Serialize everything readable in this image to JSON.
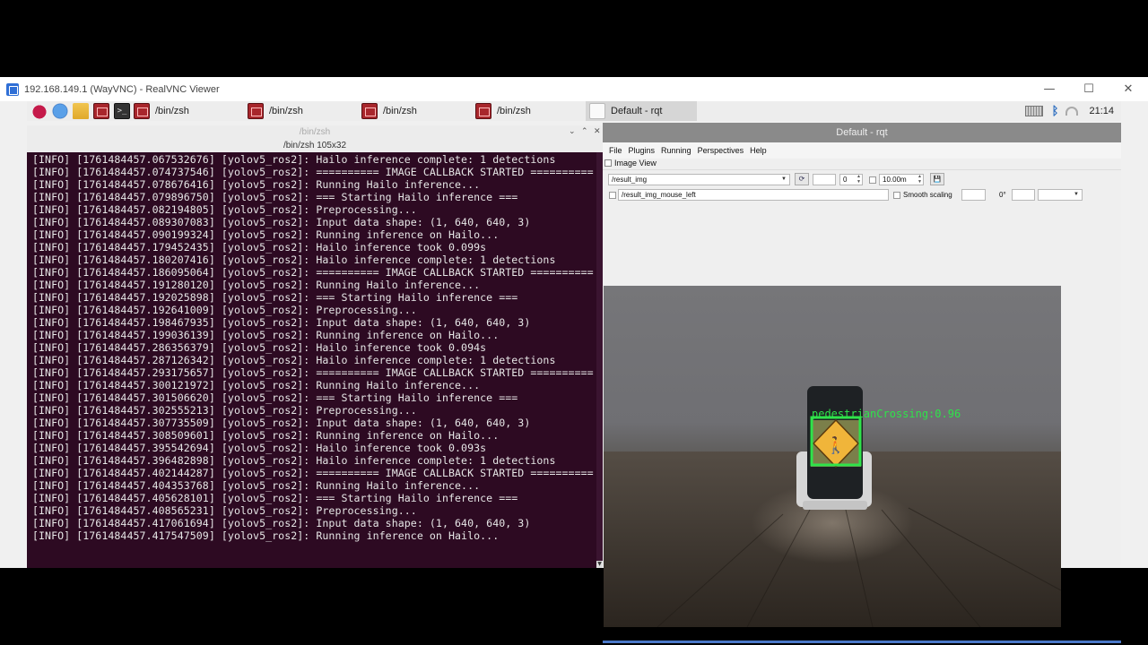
{
  "vnc": {
    "title": "192.168.149.1 (WayVNC) - RealVNC Viewer",
    "minimize": "—",
    "maximize": "☐",
    "close": "✕"
  },
  "taskbar": {
    "tasks": [
      "/bin/zsh",
      "/bin/zsh",
      "/bin/zsh",
      "/bin/zsh"
    ],
    "active_task": "Default - rqt",
    "bluetooth_glyph": "ᛒ",
    "clock": "21:14"
  },
  "terminal": {
    "title": "/bin/zsh",
    "size": "/bin/zsh 105x32",
    "btn_chevron": "⌄",
    "btn_up": "⌃",
    "btn_close": "✕",
    "lines": [
      "[INFO] [1761484457.067532676] [yolov5_ros2]: Hailo inference complete: 1 detections",
      "[INFO] [1761484457.074737546] [yolov5_ros2]: ========== IMAGE CALLBACK STARTED ==========",
      "[INFO] [1761484457.078676416] [yolov5_ros2]: Running Hailo inference...",
      "[INFO] [1761484457.079896750] [yolov5_ros2]: === Starting Hailo inference ===",
      "[INFO] [1761484457.082194805] [yolov5_ros2]: Preprocessing...",
      "[INFO] [1761484457.089307083] [yolov5_ros2]: Input data shape: (1, 640, 640, 3)",
      "[INFO] [1761484457.090199324] [yolov5_ros2]: Running inference on Hailo...",
      "[INFO] [1761484457.179452435] [yolov5_ros2]: Hailo inference took 0.099s",
      "[INFO] [1761484457.180207416] [yolov5_ros2]: Hailo inference complete: 1 detections",
      "[INFO] [1761484457.186095064] [yolov5_ros2]: ========== IMAGE CALLBACK STARTED ==========",
      "[INFO] [1761484457.191280120] [yolov5_ros2]: Running Hailo inference...",
      "[INFO] [1761484457.192025898] [yolov5_ros2]: === Starting Hailo inference ===",
      "[INFO] [1761484457.192641009] [yolov5_ros2]: Preprocessing...",
      "[INFO] [1761484457.198467935] [yolov5_ros2]: Input data shape: (1, 640, 640, 3)",
      "[INFO] [1761484457.199036139] [yolov5_ros2]: Running inference on Hailo...",
      "[INFO] [1761484457.286356379] [yolov5_ros2]: Hailo inference took 0.094s",
      "[INFO] [1761484457.287126342] [yolov5_ros2]: Hailo inference complete: 1 detections",
      "[INFO] [1761484457.293175657] [yolov5_ros2]: ========== IMAGE CALLBACK STARTED ==========",
      "[INFO] [1761484457.300121972] [yolov5_ros2]: Running Hailo inference...",
      "[INFO] [1761484457.301506620] [yolov5_ros2]: === Starting Hailo inference ===",
      "[INFO] [1761484457.302555213] [yolov5_ros2]: Preprocessing...",
      "[INFO] [1761484457.307735509] [yolov5_ros2]: Input data shape: (1, 640, 640, 3)",
      "[INFO] [1761484457.308509601] [yolov5_ros2]: Running inference on Hailo...",
      "[INFO] [1761484457.395542694] [yolov5_ros2]: Hailo inference took 0.093s",
      "[INFO] [1761484457.396482898] [yolov5_ros2]: Hailo inference complete: 1 detections",
      "[INFO] [1761484457.402144287] [yolov5_ros2]: ========== IMAGE CALLBACK STARTED ==========",
      "[INFO] [1761484457.404353768] [yolov5_ros2]: Running Hailo inference...",
      "[INFO] [1761484457.405628101] [yolov5_ros2]: === Starting Hailo inference ===",
      "[INFO] [1761484457.408565231] [yolov5_ros2]: Preprocessing...",
      "[INFO] [1761484457.417061694] [yolov5_ros2]: Input data shape: (1, 640, 640, 3)",
      "[INFO] [1761484457.417547509] [yolov5_ros2]: Running inference on Hailo..."
    ]
  },
  "rqt": {
    "title": "Default - rqt",
    "menu": [
      "File",
      "Plugins",
      "Running",
      "Perspectives",
      "Help"
    ],
    "plugin_label": "Image View",
    "topic": "/result_img",
    "refresh_glyph": "⟳",
    "spin_value": "0",
    "timeout": "10.00m",
    "save_glyph": "💾",
    "mouse_topic": "/result_img_mouse_left",
    "smooth_scaling": "Smooth scaling",
    "rotation": "0°",
    "detection": {
      "label": "pedestrianCrossing:0.96",
      "color": "#2fe34a"
    }
  }
}
